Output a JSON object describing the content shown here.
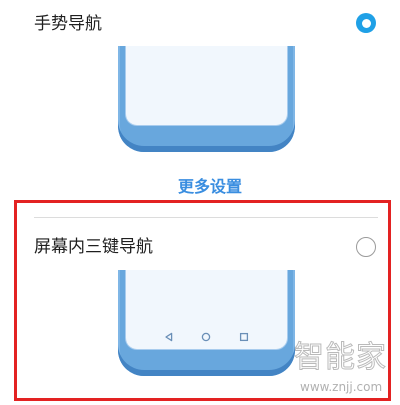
{
  "gesture_nav": {
    "label": "手势导航",
    "selected": true
  },
  "more_settings": {
    "label": "更多设置"
  },
  "three_key_nav": {
    "label": "屏幕内三键导航",
    "selected": false,
    "nav_icons": [
      "back-icon",
      "home-icon",
      "recents-icon"
    ]
  },
  "colors": {
    "accent": "#1fa0e6",
    "link": "#3a8ee0",
    "highlight": "#e32222",
    "phone_body": "#68a7dd",
    "phone_edge": "#4384c4"
  },
  "watermark": {
    "title": "智能家",
    "url": "www.znjj.com"
  }
}
